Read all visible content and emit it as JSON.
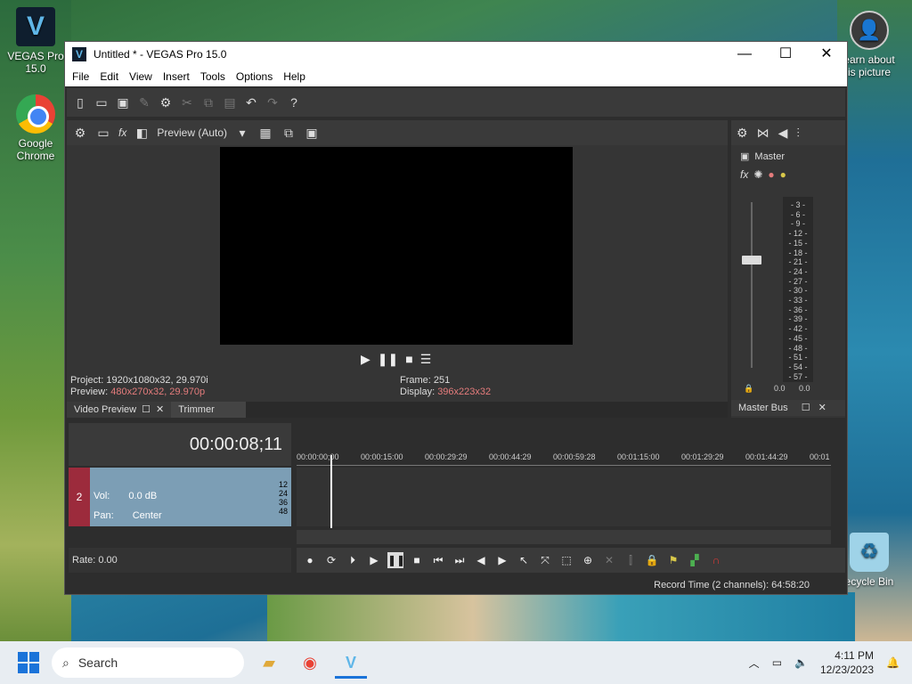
{
  "desktop": {
    "icons": [
      {
        "label": "VEGAS Pro 15.0",
        "glyph": "V"
      },
      {
        "label": "Google Chrome",
        "glyph": ""
      },
      {
        "label": "earn about\nis picture",
        "glyph": "👤"
      },
      {
        "label": "ecycle Bin",
        "glyph": "♻"
      }
    ]
  },
  "window": {
    "title": "Untitled * - VEGAS Pro 15.0",
    "app_glyph": "V",
    "controls": {
      "minimize": "—",
      "maximize": "☐",
      "close": "✕"
    },
    "menu": [
      "File",
      "Edit",
      "View",
      "Insert",
      "Tools",
      "Options",
      "Help"
    ]
  },
  "preview": {
    "quality_label": "Preview (Auto)",
    "fx_label": "fx",
    "project_label": "Project:",
    "project_value": "1920x1080x32, 29.970i",
    "preview_label": "Preview:",
    "preview_value": "480x270x32, 29.970p",
    "frame_label": "Frame:",
    "frame_value": "251",
    "display_label": "Display:",
    "display_value": "396x223x32",
    "tabs": [
      "Video Preview",
      "Trimmer"
    ]
  },
  "master_bus": {
    "name": "Master",
    "fx_label": "fx",
    "scale": [
      "3",
      "6",
      "9",
      "12",
      "15",
      "18",
      "21",
      "24",
      "27",
      "30",
      "33",
      "36",
      "39",
      "42",
      "45",
      "48",
      "51",
      "54",
      "57"
    ],
    "left_read": "0.0",
    "right_read": "0.0",
    "tab_label": "Master Bus"
  },
  "timeline": {
    "timecode": "00:00:08;11",
    "ruler": [
      "00:00:00;00",
      "00:00:15:00",
      "00:00:29:29",
      "00:00:44:29",
      "00:00:59:28",
      "00:01:15:00",
      "00:01:29:29",
      "00:01:44:29",
      "00:01"
    ],
    "track": {
      "number": "2",
      "vol_label": "Vol:",
      "vol_value": "0.0 dB",
      "pan_label": "Pan:",
      "pan_value": "Center",
      "meter": [
        "12",
        "24",
        "36",
        "48"
      ]
    },
    "rate_label": "Rate: 0.00"
  },
  "status": {
    "record_time": "Record Time (2 channels): 64:58:20"
  },
  "taskbar": {
    "search_placeholder": "Search",
    "time": "4:11 PM",
    "date": "12/23/2023"
  },
  "colors": {
    "accent": "#e57c7c",
    "track_number_bg": "#9c2b3c",
    "track_header_bg": "#7c9eb5"
  }
}
